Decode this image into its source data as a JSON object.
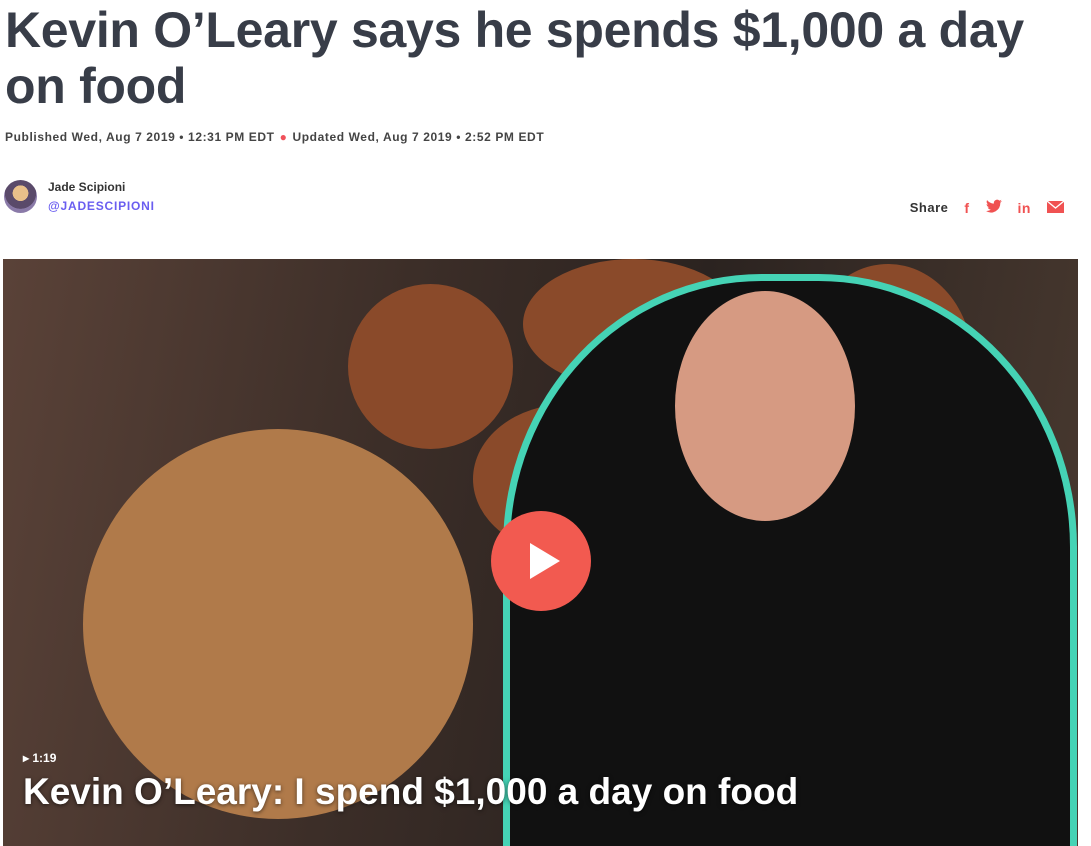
{
  "headline": "Kevin O’Leary says he spends $1,000 a day on food",
  "meta": {
    "published": "Published Wed, Aug 7 2019 • 12:31 PM EDT",
    "updated": "Updated Wed, Aug 7 2019 • 2:52 PM EDT"
  },
  "author": {
    "name": "Jade Scipioni",
    "handle": "@JADESCIPIONI"
  },
  "share": {
    "label": "Share",
    "icons": [
      "facebook-icon",
      "twitter-icon",
      "linkedin-icon",
      "email-icon"
    ],
    "f": "f",
    "in": "in"
  },
  "video": {
    "duration": "▸ 1:19",
    "title": "Kevin O’Leary: I spend $1,000 a day on food"
  },
  "colors": {
    "accent": "#f05252",
    "handle": "#6a5ef0",
    "outline": "#45d3b5"
  }
}
